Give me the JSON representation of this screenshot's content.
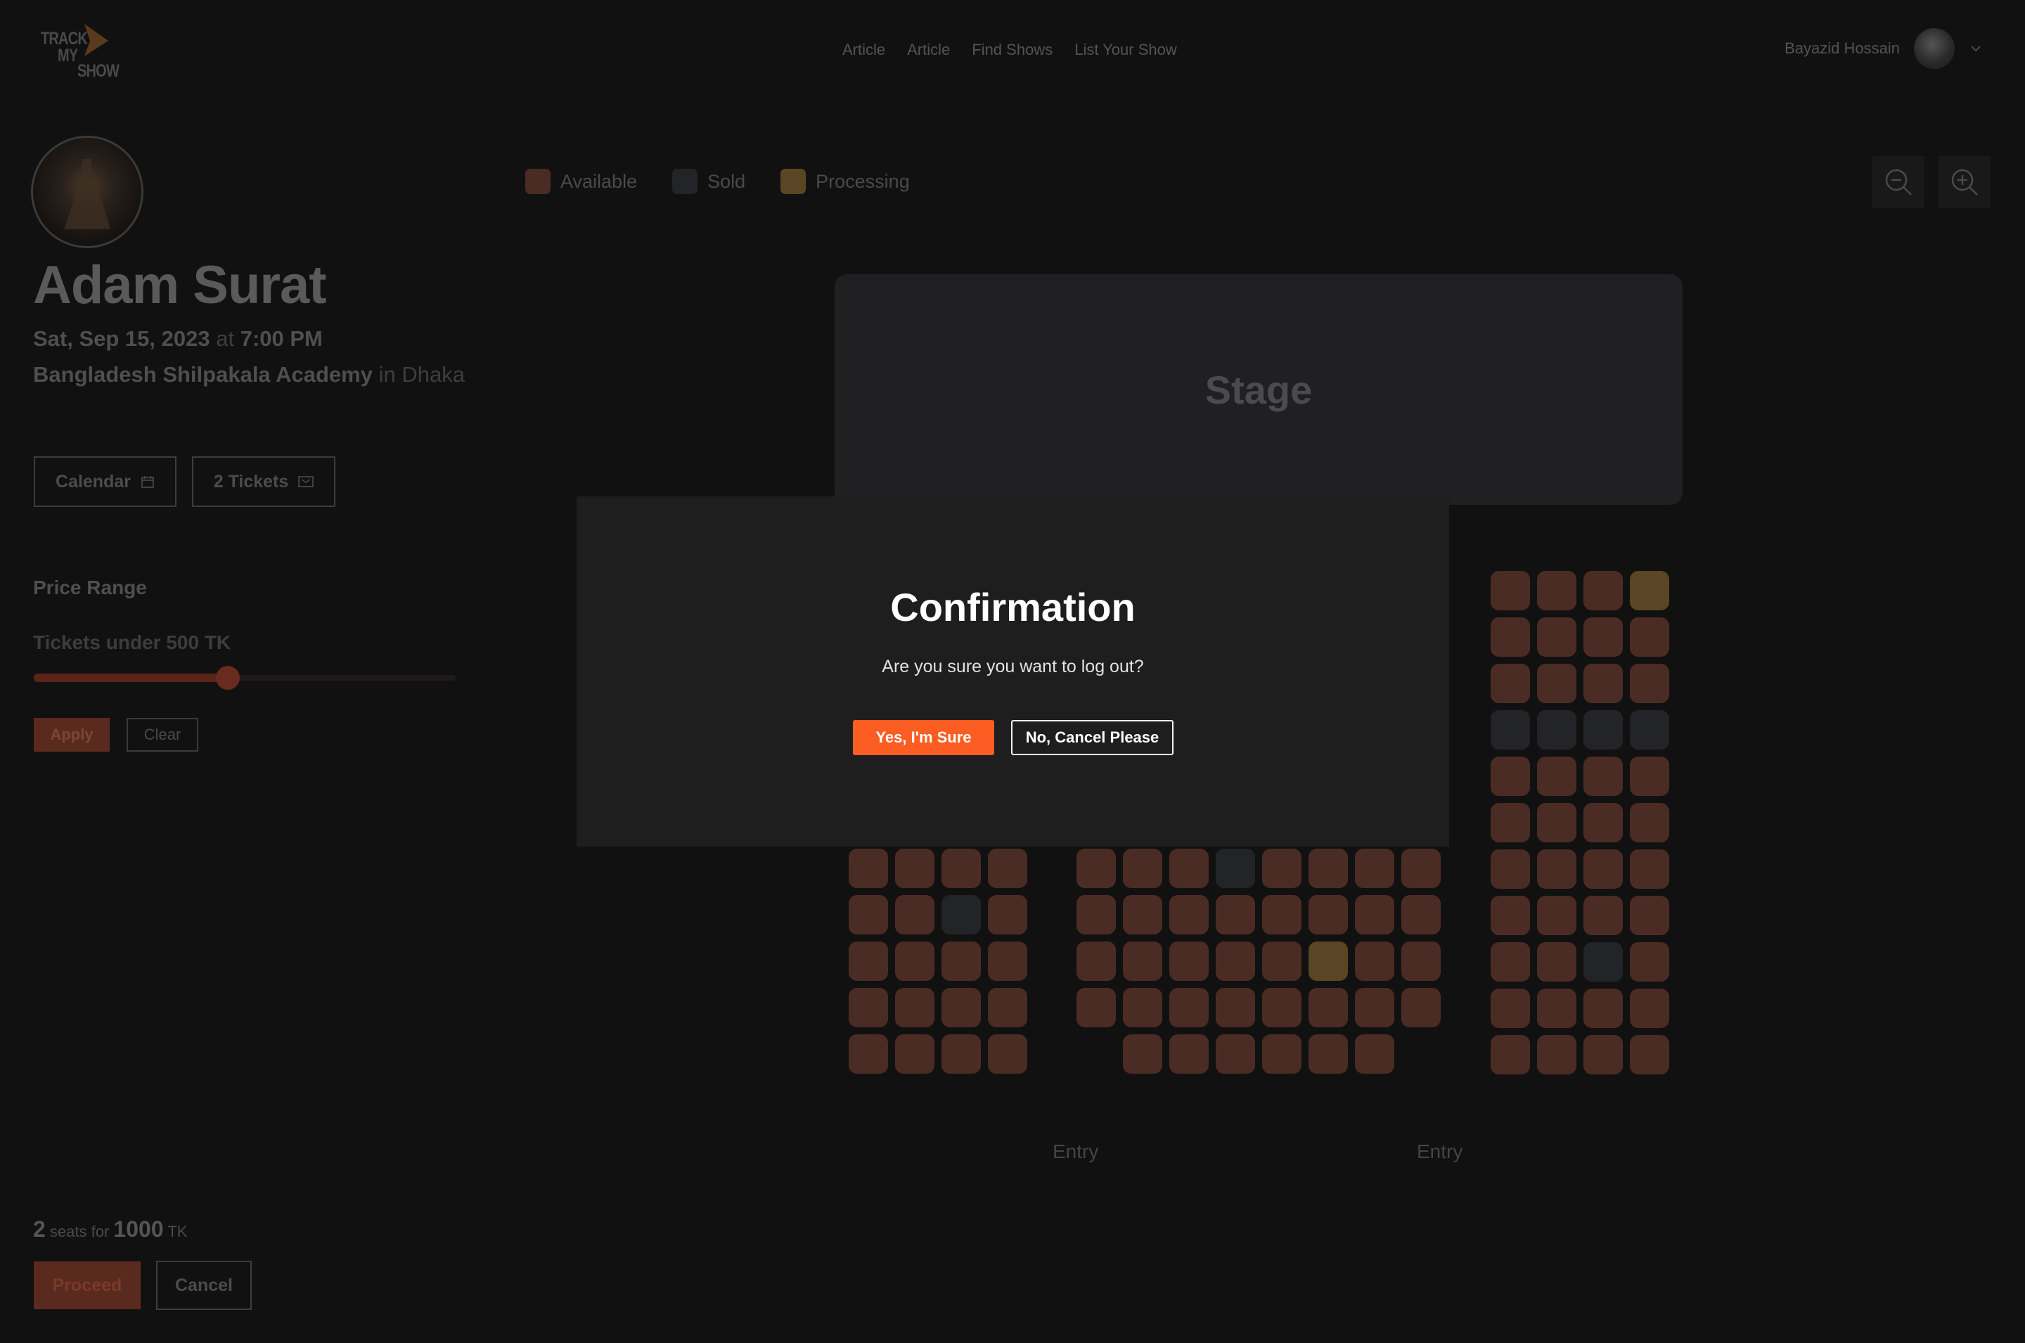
{
  "header": {
    "logo_lines": [
      "TRACK",
      "MY",
      "SHOW"
    ],
    "nav": [
      "Article",
      "Article",
      "Find Shows",
      "List Your Show"
    ],
    "user_name": "Bayazid Hossain"
  },
  "event": {
    "artist": "Adam Surat",
    "date": "Sat, Sep 15, 2023",
    "at": "at",
    "time": "7:00 PM",
    "venue": "Bangladesh Shilpakala Academy",
    "in": "in",
    "city": "Dhaka"
  },
  "actions": {
    "calendar_label": "Calendar",
    "tickets_label": "2 Tickets"
  },
  "price": {
    "title": "Price Range",
    "label": "Tickets under 500 TK",
    "slider_fraction": 0.46,
    "apply_label": "Apply",
    "clear_label": "Clear"
  },
  "legend": [
    {
      "label": "Available",
      "color": "#4b2c24"
    },
    {
      "label": "Sold",
      "color": "#232427"
    },
    {
      "label": "Processing",
      "color": "#5a4624"
    }
  ],
  "stage_label": "Stage",
  "entries": [
    "Entry",
    "Entry"
  ],
  "summary": {
    "seats": "2",
    "seats_for": "seats for",
    "amount": "1000",
    "currency": "TK",
    "proceed_label": "Proceed",
    "cancel_label": "Cancel"
  },
  "modal": {
    "title": "Confirmation",
    "message": "Are you sure you want to log out?",
    "yes_label": "Yes, I'm Sure",
    "no_label": "No, Cancel Please"
  },
  "seat_colors": {
    "available": "#4b2c24",
    "sold": "#232427",
    "processing": "#5a4624"
  }
}
